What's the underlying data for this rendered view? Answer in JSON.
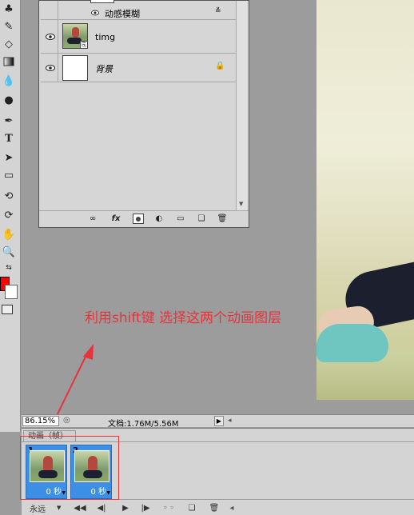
{
  "layers_panel": {
    "layers": [
      {
        "name": "动感模糊",
        "type": "effect"
      },
      {
        "name": "timg",
        "type": "smart-object"
      },
      {
        "name": "背景",
        "type": "background",
        "locked": true
      }
    ],
    "footer_icons": [
      "link-icon",
      "fx-icon",
      "mask-icon",
      "adjustment-icon",
      "group-icon",
      "new-layer-icon",
      "trash-icon"
    ],
    "fx_label": "fx"
  },
  "annotation": {
    "text": "利用shift键 选择这两个动画图层",
    "color": "#e8333a"
  },
  "status": {
    "zoom": "86.15%",
    "doc_info": "文档:1.76M/5.56M"
  },
  "animation": {
    "tab_label": "动画（帧）",
    "frames": [
      {
        "number": "1",
        "delay": "0 秒"
      },
      {
        "number": "2",
        "delay": "0 秒"
      }
    ],
    "loop": "永远"
  },
  "colors": {
    "foreground": "#ff0000",
    "background": "#ffffff",
    "frame_selected": "#3d8fe6"
  }
}
